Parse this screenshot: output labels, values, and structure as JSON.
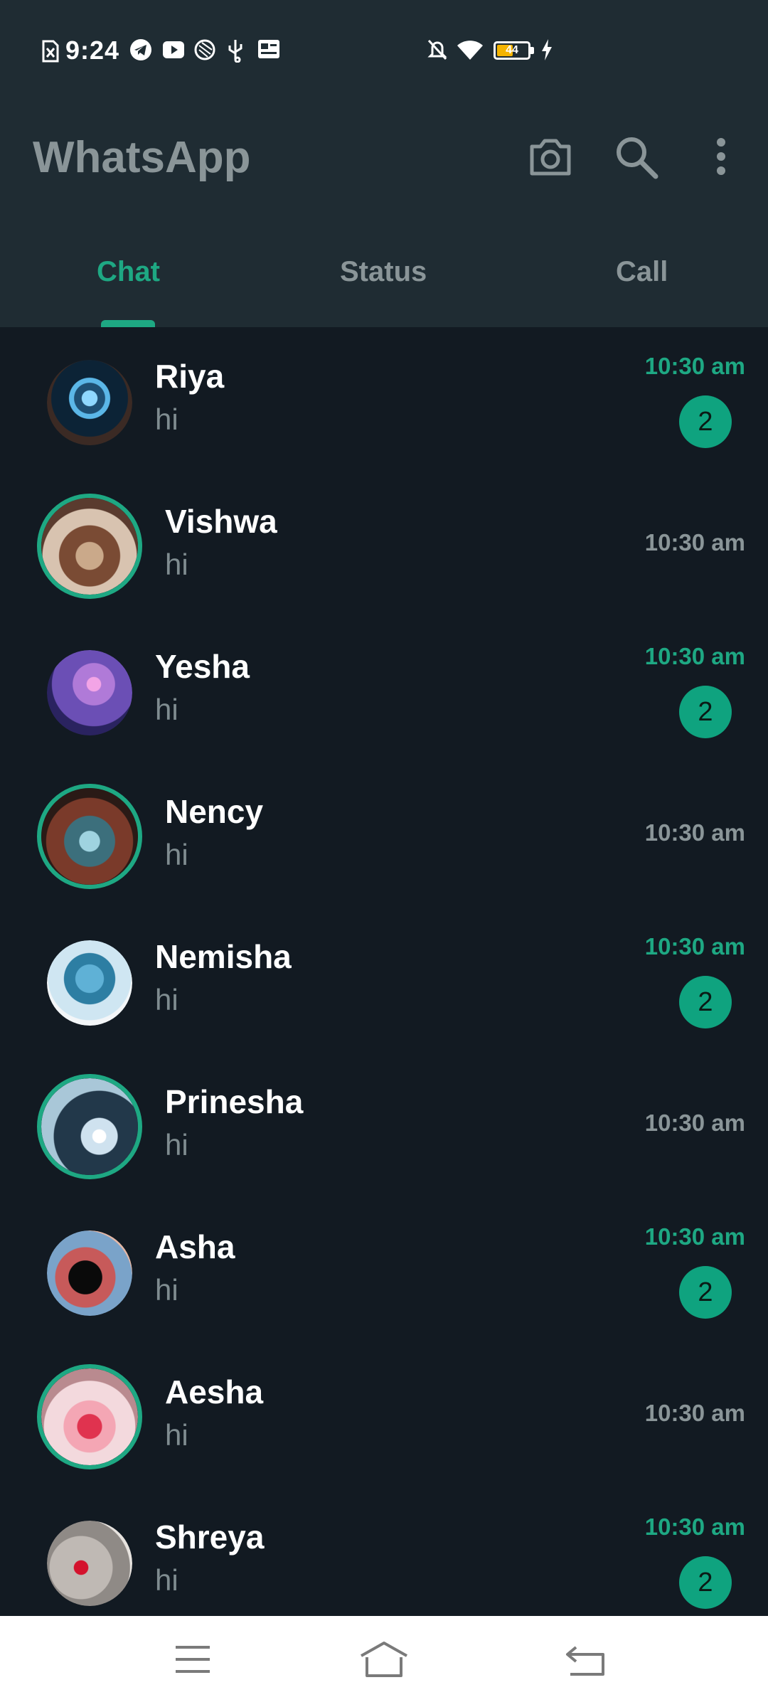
{
  "status_bar": {
    "time": "9:24",
    "battery_level": "44",
    "icons": [
      "sim-off-icon",
      "telegram-icon",
      "youtube-icon",
      "flag-icon",
      "usb-icon",
      "news-icon",
      "bell-off-icon",
      "wifi-icon",
      "battery-icon",
      "charging-icon"
    ]
  },
  "app_bar": {
    "title": "WhatsApp",
    "actions": [
      "camera-icon",
      "search-icon",
      "more-vert-icon"
    ]
  },
  "tabs": [
    {
      "label": "Chat",
      "active": true
    },
    {
      "label": "Status",
      "active": false
    },
    {
      "label": "Call",
      "active": false
    }
  ],
  "colors": {
    "accent": "#1ea883",
    "background": "#121a22",
    "header": "#1f2c33",
    "muted_text": "#8a9598"
  },
  "chats": [
    {
      "name": "Riya",
      "message": "hi",
      "time": "10:30 am",
      "unread": 2,
      "has_status": false
    },
    {
      "name": "Vishwa",
      "message": "hi",
      "time": "10:30 am",
      "unread": null,
      "has_status": true
    },
    {
      "name": "Yesha",
      "message": "hi",
      "time": "10:30 am",
      "unread": 2,
      "has_status": false
    },
    {
      "name": "Nency",
      "message": "hi",
      "time": "10:30 am",
      "unread": null,
      "has_status": true
    },
    {
      "name": "Nemisha",
      "message": "hi",
      "time": "10:30 am",
      "unread": 2,
      "has_status": false
    },
    {
      "name": "Prinesha",
      "message": "hi",
      "time": "10:30 am",
      "unread": null,
      "has_status": true
    },
    {
      "name": "Asha",
      "message": "hi",
      "time": "10:30 am",
      "unread": 2,
      "has_status": false
    },
    {
      "name": "Aesha",
      "message": "hi",
      "time": "10:30 am",
      "unread": null,
      "has_status": true
    },
    {
      "name": "Shreya",
      "message": "hi",
      "time": "10:30 am",
      "unread": 2,
      "has_status": false
    }
  ],
  "nav_bar": {
    "buttons": [
      "menu-icon",
      "home-icon",
      "back-icon"
    ]
  }
}
